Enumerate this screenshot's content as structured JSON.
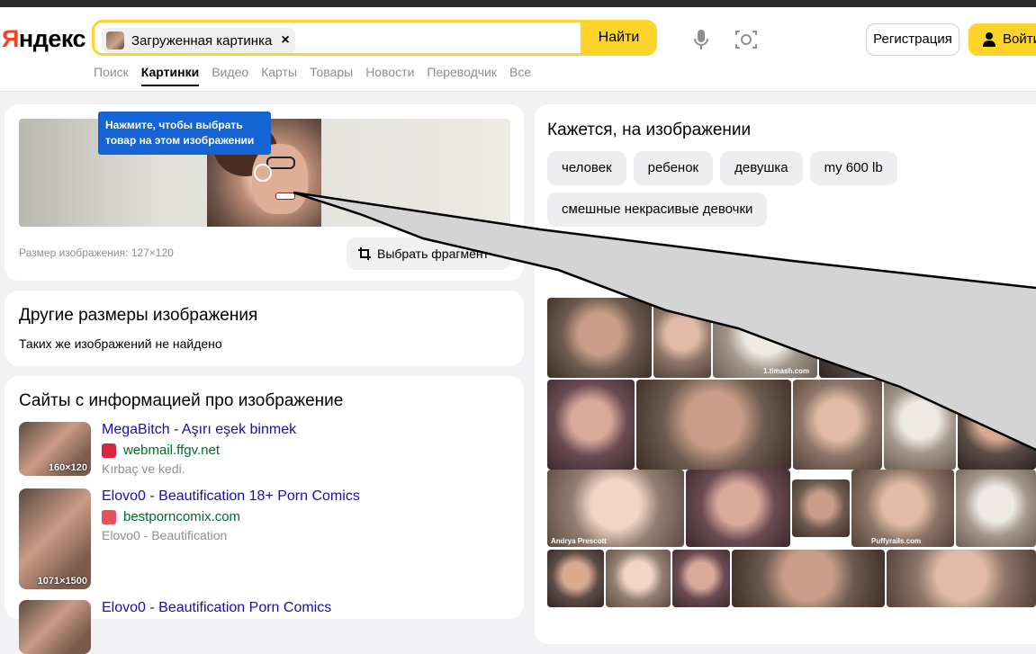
{
  "logo": "Яндекс",
  "search": {
    "chip_label": "Загруженная картинка",
    "clear_icon": "×",
    "find_label": "Найти"
  },
  "header": {
    "register_label": "Регистрация",
    "login_label": "Войти"
  },
  "tabs": [
    {
      "label": "Поиск",
      "active": false
    },
    {
      "label": "Картинки",
      "active": true
    },
    {
      "label": "Видео",
      "active": false
    },
    {
      "label": "Карты",
      "active": false
    },
    {
      "label": "Товары",
      "active": false
    },
    {
      "label": "Новости",
      "active": false
    },
    {
      "label": "Переводчик",
      "active": false
    },
    {
      "label": "Все",
      "active": false
    }
  ],
  "preview": {
    "tooltip": "Нажмите, чтобы выбрать товар на этом изображении",
    "size_text": "Размер изображения: 127×120",
    "fragment_button": "Выбрать фрагмент"
  },
  "other_sizes": {
    "title": "Другие размеры изображения",
    "message": "Таких же изображений не найдено"
  },
  "sites": {
    "title": "Сайты с информацией про изображение",
    "items": [
      {
        "title": "MegaBitch - Aşırı eşek binmek",
        "domain": "webmail.ffgv.net",
        "desc": "Kırbaç ve kedi.",
        "dims": "160×120",
        "favicon_color": "#d7263d"
      },
      {
        "title": "Elovo0 - Beautification 18+ Porn Comics",
        "domain": "bestporncomix.com",
        "desc": "Elovo0 - Beautification",
        "dims": "1071×1500",
        "favicon_color": "#e8505b"
      },
      {
        "title": "Elovo0 - Beautification Porn Comics",
        "domain": "",
        "desc": "",
        "dims": "",
        "favicon_color": "#e8505b"
      }
    ]
  },
  "seems": {
    "title": "Кажется, на изображении",
    "tags": [
      "человек",
      "ребенок",
      "девушка",
      "my 600 lb",
      "смешные некрасивые девочки"
    ]
  },
  "similar": {
    "watermarks": [
      "Andrya Prescott",
      "Puffyrails.com",
      "1.timash.com"
    ]
  },
  "colors": {
    "accent": "#fed42b",
    "link": "#1a0dab",
    "domain": "#006b2d",
    "tooltip": "#1464d6"
  }
}
